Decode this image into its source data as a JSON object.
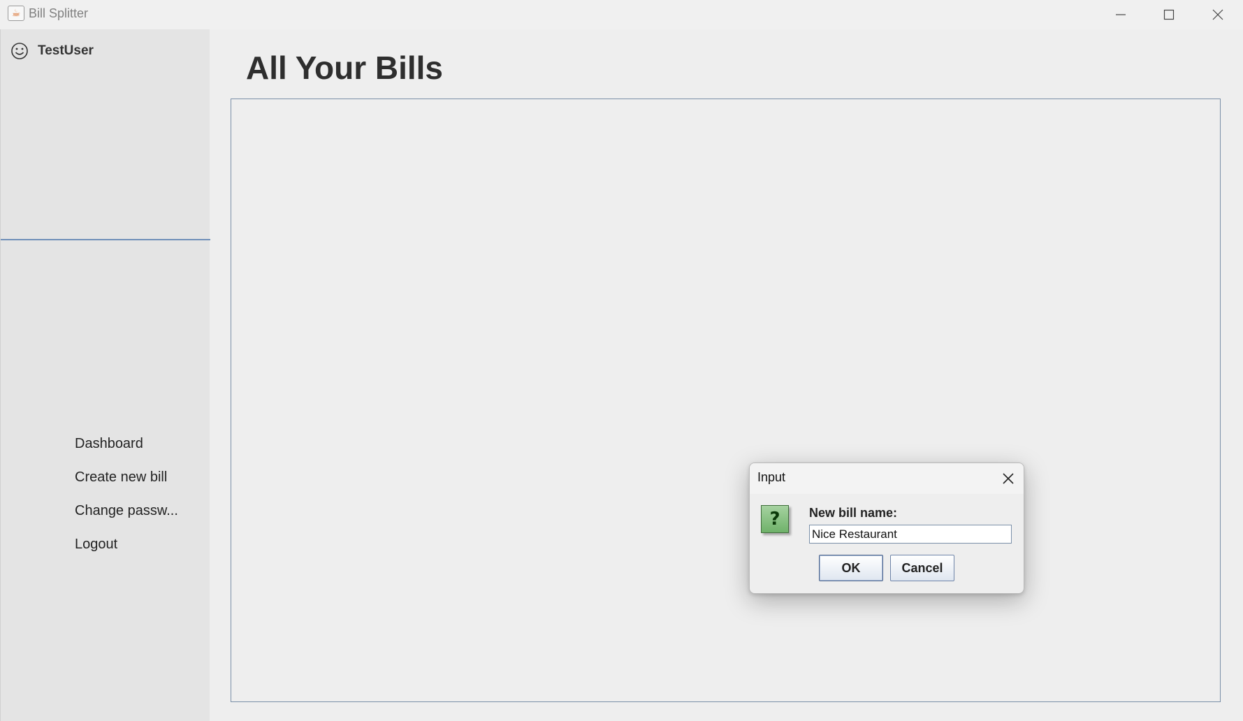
{
  "window": {
    "title": "Bill Splitter",
    "icon": "java-cup-icon"
  },
  "sidebar": {
    "user": {
      "name": "TestUser",
      "icon": "smiley-icon"
    },
    "nav": [
      {
        "label": "Dashboard"
      },
      {
        "label": "Create new bill"
      },
      {
        "label": "Change passw..."
      },
      {
        "label": "Logout"
      }
    ]
  },
  "main": {
    "title": "All Your Bills"
  },
  "dialog": {
    "title": "Input",
    "icon": "question-icon",
    "prompt": "New bill name:",
    "input_value": "Nice Restaurant",
    "ok_label": "OK",
    "cancel_label": "Cancel"
  }
}
